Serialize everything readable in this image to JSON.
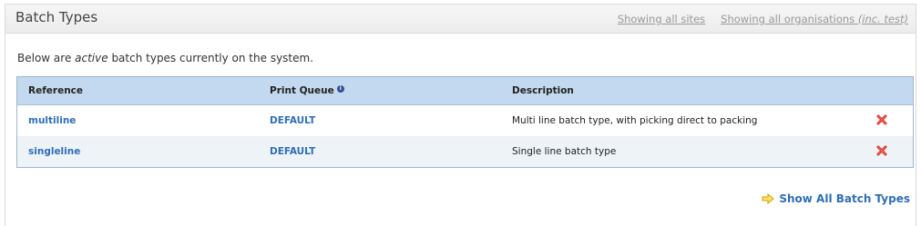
{
  "header": {
    "title": "Batch Types",
    "link_sites": "Showing all sites",
    "link_orgs": "Showing all organisations",
    "link_orgs_note": "(inc. test)"
  },
  "intro": {
    "before": "Below are ",
    "emphasis": "active",
    "after": " batch types currently on the system."
  },
  "table": {
    "columns": {
      "reference": "Reference",
      "print_queue": "Print Queue",
      "description": "Description"
    },
    "rows": [
      {
        "reference": "multiline",
        "print_queue": "DEFAULT",
        "description": "Multi line batch type, with picking direct to packing"
      },
      {
        "reference": "singleline",
        "print_queue": "DEFAULT",
        "description": "Single line batch type"
      }
    ]
  },
  "footer": {
    "show_all_label": "Show All Batch Types"
  },
  "icons": {
    "info": "info-icon",
    "delete": "delete-icon",
    "arrow": "arrow-right-icon"
  },
  "colors": {
    "link": "#2f6eb5",
    "table_header": "#c3d9ef",
    "delete_red": "#d9302b",
    "arrow_yellow": "#e8b000"
  }
}
